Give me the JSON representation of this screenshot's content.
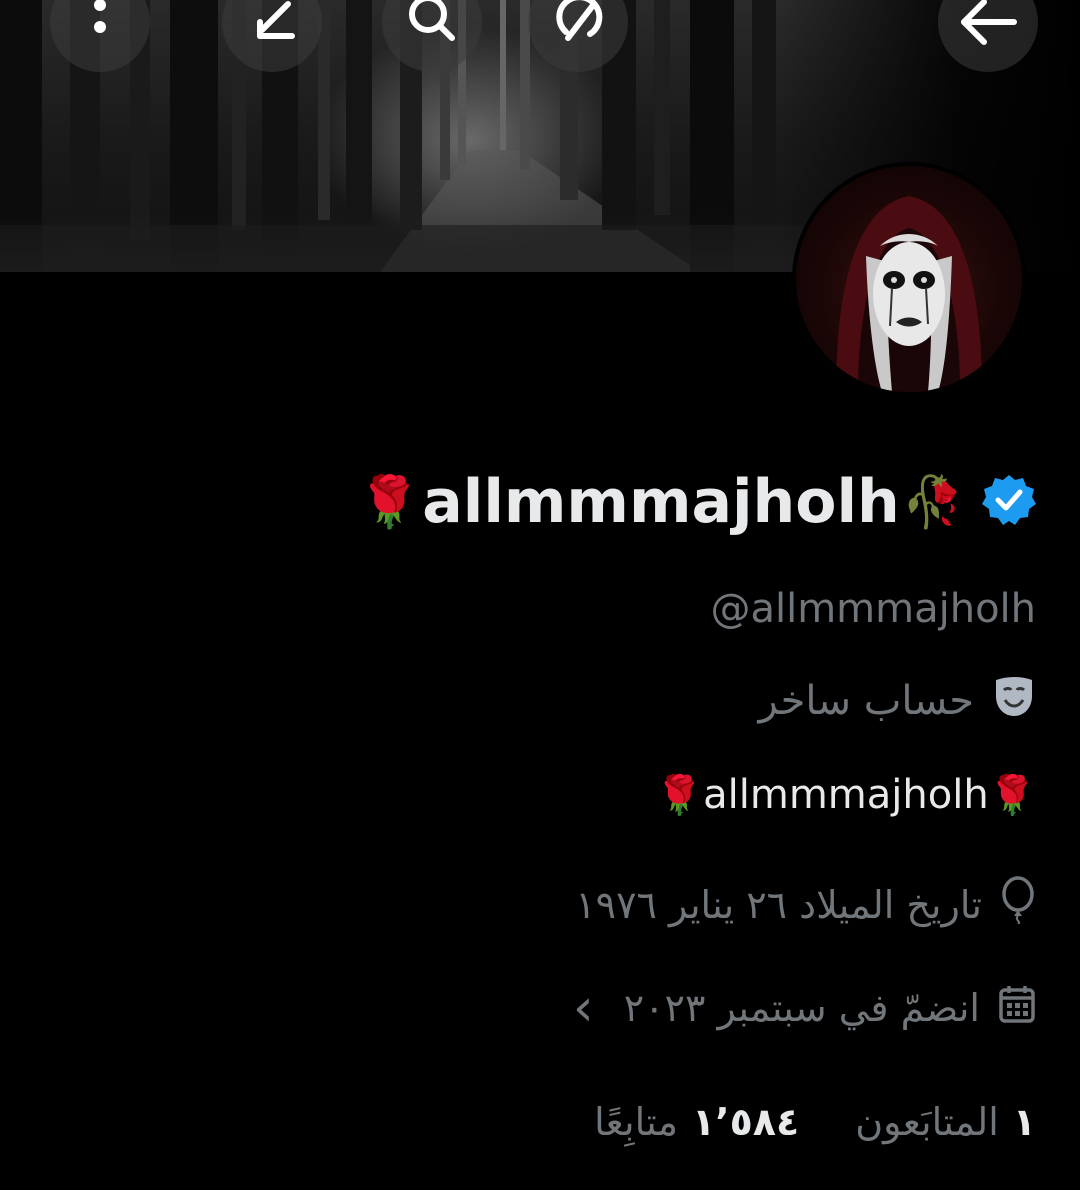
{
  "header": {
    "back_icon": "arrow-left-icon",
    "actions": [
      {
        "name": "more-icon"
      },
      {
        "name": "edit-icon"
      },
      {
        "name": "search-icon"
      },
      {
        "name": "grok-icon"
      }
    ]
  },
  "profile": {
    "display_name": "allmmmajholh",
    "name_prefix_emoji": "🌹",
    "name_suffix_emoji": "🥀",
    "verified_color": "#1d9bf0",
    "handle": "@allmmmajholh",
    "bio": "حساب ساخر",
    "bio_icon": "theater-mask-icon",
    "link": {
      "text": "allmmmajholh",
      "prefix_emoji": "🌹",
      "suffix_emoji": "🌹"
    },
    "birth": {
      "icon": "balloon-icon",
      "text": "تاريخ الميلاد ٢٦ يناير ١٩٧٦"
    },
    "joined": {
      "icon": "calendar-icon",
      "text": "انضمّ في سبتمبر ٢٠٢٣",
      "chevron": "‹"
    },
    "stats": {
      "following": {
        "count": "١٬٥٨٤",
        "label": "متابِعًا"
      },
      "followers": {
        "count": "١",
        "label": "المتابَعون"
      }
    }
  },
  "colors": {
    "background": "#000000",
    "text_primary": "#e7e9ea",
    "text_secondary": "#71767b",
    "accent": "#1d9bf0"
  }
}
